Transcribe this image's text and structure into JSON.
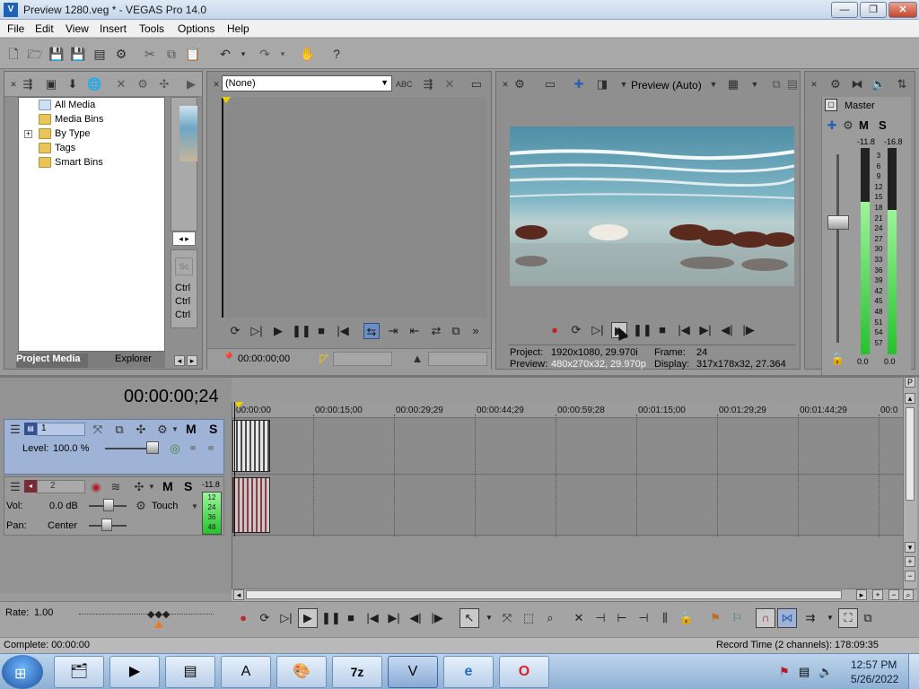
{
  "window": {
    "title": "Preview 1280.veg * - VEGAS Pro 14.0",
    "logo": "V",
    "minimize": "—",
    "maximize": "❐",
    "close": "✕"
  },
  "menu": [
    "File",
    "Edit",
    "View",
    "Insert",
    "Tools",
    "Options",
    "Help"
  ],
  "media": {
    "tree": [
      "All Media",
      "Media Bins",
      "By Type",
      "Tags",
      "Smart Bins"
    ],
    "expand": "+",
    "tabs": [
      "Project Media",
      "Explorer"
    ],
    "shortcuts": [
      "Ctrl",
      "Ctrl",
      "Ctrl"
    ]
  },
  "trimmer": {
    "dropdown": "(None)",
    "timecode": "00:00:00;00"
  },
  "preview": {
    "mode": "Preview (Auto)",
    "project_label": "Project:",
    "project_value": "1920x1080, 29.970i",
    "preview_label": "Preview:",
    "preview_value": "480x270x32, 29.970p",
    "frame_label": "Frame:",
    "frame_value": "24",
    "display_label": "Display:",
    "display_value": "317x178x32, 27.364"
  },
  "master": {
    "title": "Master",
    "m": "M",
    "s": "S",
    "peak_left": "-11.8",
    "peak_right": "-16.8",
    "scale": [
      "3",
      "6",
      "9",
      "12",
      "15",
      "18",
      "21",
      "24",
      "27",
      "30",
      "33",
      "36",
      "39",
      "42",
      "45",
      "48",
      "51",
      "54",
      "57"
    ],
    "foot_left": "0.0",
    "foot_right": "0.0",
    "level_left": 0.74,
    "level_right": 0.7
  },
  "timeline": {
    "timecode": "00:00:00;24",
    "ruler": [
      "00:00:00",
      "00:00:15;00",
      "00:00:29;29",
      "00:00:44;29",
      "00:00:59;28",
      "00:01:15;00",
      "00:01:29;29",
      "00:01:44;29",
      "00:0"
    ]
  },
  "tracks": {
    "video": {
      "number": "1",
      "m": "M",
      "s": "S",
      "level_label": "Level:",
      "level_value": "100.0 %"
    },
    "audio": {
      "number": "2",
      "m": "M",
      "s": "S",
      "peak": "-11.8",
      "meter_labels": [
        "12",
        "24",
        "36",
        "48"
      ],
      "vol_label": "Vol:",
      "vol_value": "0.0 dB",
      "touch": "Touch",
      "pan_label": "Pan:",
      "pan_value": "Center"
    }
  },
  "rate": {
    "label": "Rate:",
    "value": "1.00"
  },
  "status": {
    "left": "Complete: 00:00:00",
    "right": "Record Time (2 channels): 178:09:35"
  },
  "taskbar": {
    "time": "12:57 PM",
    "date": "5/26/2022",
    "apps": [
      "7z"
    ]
  },
  "colors": {
    "panel": "#8f8f8f",
    "video_track": "#9fb3d6",
    "meter_green": "#25c22e",
    "taskbar": "#8fb0d4"
  }
}
